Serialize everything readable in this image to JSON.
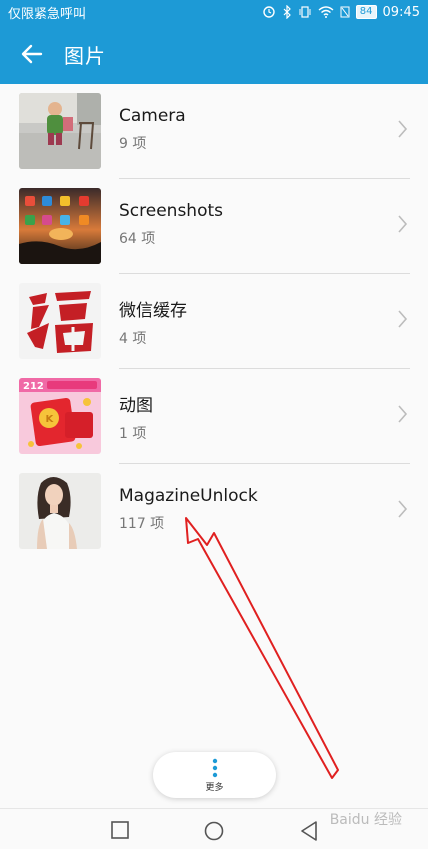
{
  "status_bar": {
    "carrier": "仅限紧急呼叫",
    "battery": "84",
    "time": "09:45"
  },
  "app_bar": {
    "title": "图片",
    "back_icon": "arrow-left-icon"
  },
  "albums": [
    {
      "name": "Camera",
      "count": "9 项"
    },
    {
      "name": "Screenshots",
      "count": "64 项"
    },
    {
      "name": "微信缓存",
      "count": "4 项"
    },
    {
      "name": "动图",
      "count": "1 项"
    },
    {
      "name": "MagazineUnlock",
      "count": "117 项"
    }
  ],
  "more_button": {
    "label": "更多",
    "icon": "more-vertical-icon"
  },
  "nav_bar": {
    "icons": [
      "square-icon",
      "circle-icon",
      "triangle-back-icon"
    ]
  },
  "watermark": "Baidu 经验",
  "colors": {
    "primary": "#1d9ad6",
    "annotation_arrow": "#e02020",
    "more_dot": "#1d9ad6"
  }
}
